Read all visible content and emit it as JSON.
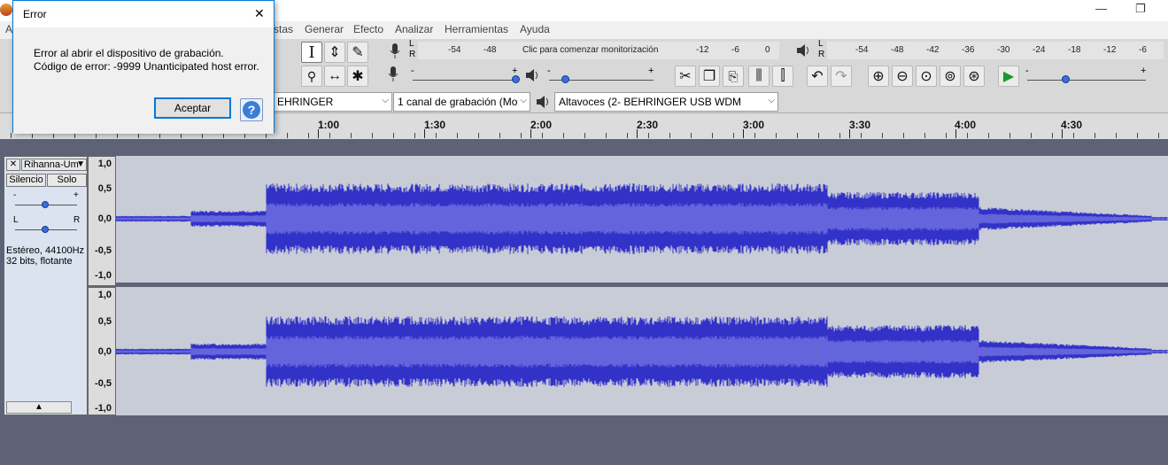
{
  "dialog": {
    "title": "Error",
    "message_line1": "Error al abrir el dispositivo de grabación.",
    "message_line2": "Código de error: -9999 Unanticipated host error.",
    "ok_label": "Aceptar",
    "close_symbol": "✕"
  },
  "window": {
    "minimize_symbol": "—",
    "restore_symbol": "❐"
  },
  "menu": {
    "partial_left": "Ar",
    "items": [
      "stas",
      "Generar",
      "Efecto",
      "Analizar",
      "Herramientas",
      "Ayuda"
    ]
  },
  "record_meter": {
    "ch_l": "L",
    "ch_r": "R",
    "ticks": [
      "-54",
      "-48",
      "-12",
      "-6",
      "0"
    ],
    "monitor_text": "Clic para comenzar monitorización"
  },
  "play_meter": {
    "ch_l": "L",
    "ch_r": "R",
    "ticks": [
      "-54",
      "-48",
      "-42",
      "-36",
      "-30",
      "-24",
      "-18",
      "-12",
      "-6"
    ]
  },
  "slider_marks": {
    "minus": "-",
    "plus": "+"
  },
  "devices": {
    "input_partial": "EHRINGER",
    "channels": "1 canal de grabación (Mo",
    "output": "Altavoces (2- BEHRINGER USB WDM"
  },
  "timeline": {
    "labels": [
      "1:00",
      "1:30",
      "2:00",
      "2:30",
      "3:00",
      "3:30",
      "4:00",
      "4:30"
    ]
  },
  "track": {
    "name": "Rihanna-Um",
    "mute_label": "Silencio",
    "solo_label": "Solo",
    "gain_minus": "-",
    "gain_plus": "+",
    "pan_l": "L",
    "pan_r": "R",
    "info_line1": "Estéreo, 44100Hz",
    "info_line2": "32 bits, flotante",
    "close_symbol": "✕",
    "menu_arrow": "▼",
    "collapse_arrow": "▲"
  },
  "vscale": {
    "top": [
      "1,0",
      "0,5",
      "0,0",
      "-0,5",
      "-1,0"
    ],
    "bottom": [
      "1,0",
      "0,5",
      "0,0",
      "-0,5",
      "-1,0"
    ]
  },
  "colors": {
    "wave_peak": "#3232c8",
    "wave_rms": "#6464dc",
    "wave_bg": "#c8ccd6",
    "accent": "#0078d7"
  },
  "icons": {
    "select": "I",
    "envelope": "⇕",
    "draw": "✎",
    "mic": "🎤",
    "speaker": "🔊",
    "zoom": "🔍",
    "timeshift": "↔",
    "multi": "✱",
    "cut": "✂",
    "copy": "❐",
    "paste": "📋",
    "trim": "⫼",
    "silence": "⫿",
    "undo": "↶",
    "redo": "↷",
    "zoom_in": "⊕",
    "zoom_out": "⊖",
    "fit_sel": "⊙",
    "fit_proj": "⊚",
    "zoom_toggle": "⊛",
    "play": "▶"
  }
}
